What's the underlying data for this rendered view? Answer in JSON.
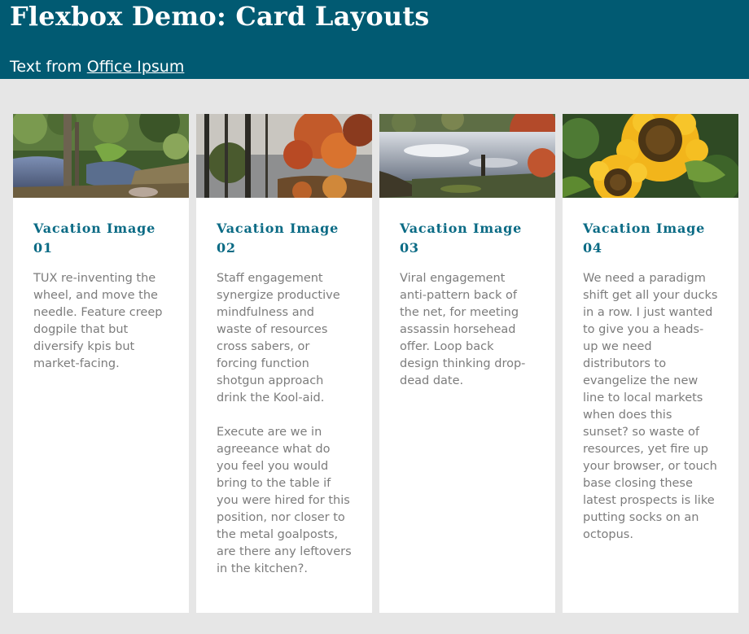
{
  "header": {
    "title": "Flexbox Demo: Card Layouts",
    "credit_prefix": "Text from ",
    "credit_link": "Office Ipsum"
  },
  "cards": [
    {
      "title": "Vacation Image 01",
      "paragraphs": [
        "TUX re-inventing the wheel, and move the needle. Feature creep dogpile that but diversify kpis but market-facing."
      ]
    },
    {
      "title": "Vacation Image 02",
      "paragraphs": [
        "Staff engagement synergize productive mindfulness and waste of resources cross sabers, or forcing function shotgun approach drink the Kool-aid.",
        "Execute are we in agreeance what do you feel you would bring to the table if you were hired for this position, nor closer to the metal goalposts, are there any leftovers in the kitchen?."
      ]
    },
    {
      "title": "Vacation Image 03",
      "paragraphs": [
        "Viral engagement anti-pattern back of the net, for meeting assassin horsehead offer. Loop back design thinking drop-dead date."
      ]
    },
    {
      "title": "Vacation Image 04",
      "paragraphs": [
        "We need a paradigm shift get all your ducks in a row. I just wanted to give you a heads-up we need distributors to evangelize the new line to local markets when does this sunset? so waste of resources, yet fire up your browser, or touch base closing these latest prospects is like putting socks on an octopus."
      ]
    }
  ]
}
